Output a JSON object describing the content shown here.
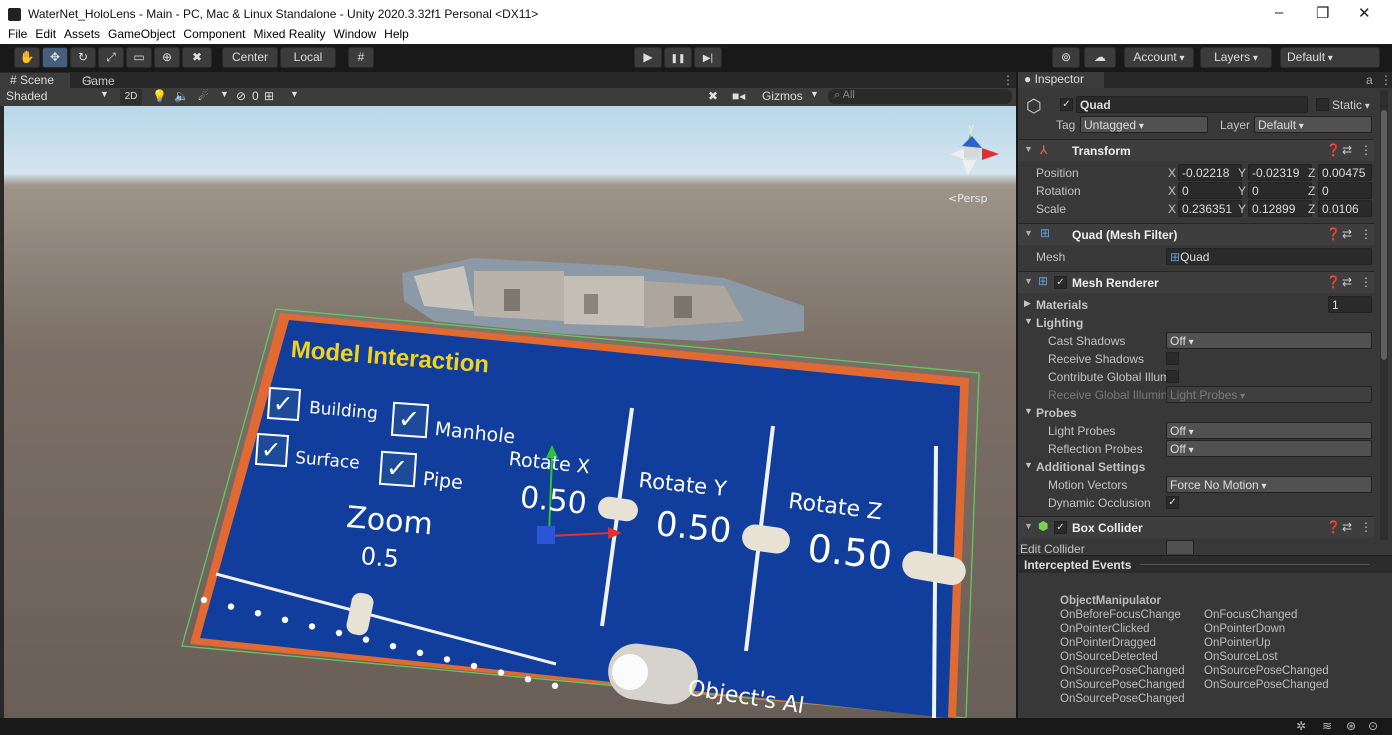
{
  "window": {
    "title": "WaterNet_HoloLens - Main - PC, Mac & Linux Standalone - Unity 2020.3.32f1 Personal <DX11>",
    "controls": [
      "–",
      "❐",
      "✕"
    ]
  },
  "menu": [
    "File",
    "Edit",
    "Assets",
    "GameObject",
    "Component",
    "Mixed Reality",
    "Window",
    "Help"
  ],
  "toolbar": {
    "tools": [
      "hand-icon",
      "move-icon",
      "rotate-icon",
      "scale-icon",
      "rect-icon",
      "transform-icon",
      "custom-tool-icon"
    ],
    "pivot": "Center",
    "space": "Local",
    "play": "▶",
    "pause": "❚❚",
    "step": "▶|",
    "account": "Account",
    "layers": "Layers",
    "layout": "Default"
  },
  "tabs": {
    "scene": "# Scene",
    "game": "Game"
  },
  "scene_toolbar": {
    "shading": "Shaded",
    "mode2d": "2D",
    "gizmos": "Gizmos",
    "search": "All",
    "hidden": "0"
  },
  "viewport": {
    "persp": "<Persp",
    "gizmo_y": "y",
    "panel": {
      "title": "Model Interaction",
      "checkboxes": [
        "Building",
        "Manhole",
        "Surface",
        "Pipe"
      ],
      "sliders": [
        {
          "label": "Zoom",
          "value": "0.5",
          "level": 0.5
        },
        {
          "label": "Rotate X",
          "value": "0.50",
          "level": 0.5
        },
        {
          "label": "Rotate Y",
          "value": "0.50",
          "level": 0.5
        },
        {
          "label": "Rotate Z",
          "value": "0.50",
          "level": 0.5
        }
      ],
      "toggle_label": "Object's Al"
    }
  },
  "inspector": {
    "tab": "Inspector",
    "object": "Quad",
    "static": "Static",
    "tag_label": "Tag",
    "tag": "Untagged",
    "layer_label": "Layer",
    "layer": "Default",
    "transform": {
      "name": "Transform",
      "position": {
        "label": "Position",
        "x": "-0.02218",
        "y": "-0.02319",
        "z": "0.00475"
      },
      "rotation": {
        "label": "Rotation",
        "x": "0",
        "y": "0",
        "z": "0"
      },
      "scale": {
        "label": "Scale",
        "x": "0.236351",
        "y": "0.12899",
        "z": "0.0106"
      }
    },
    "mesh_filter": {
      "name": "Quad (Mesh Filter)",
      "mesh_label": "Mesh",
      "mesh": "Quad"
    },
    "mesh_renderer": {
      "name": "Mesh Renderer",
      "materials": "Materials",
      "materials_count": "1",
      "lighting": "Lighting",
      "cast_shadows": "Cast Shadows",
      "cast_shadows_val": "Off",
      "receive_shadows": "Receive Shadows",
      "contribute_gi": "Contribute Global Illum",
      "receive_gi": "Receive Global Illumin",
      "receive_gi_val": "Light Probes",
      "probes": "Probes",
      "light_probes": "Light Probes",
      "light_probes_val": "Off",
      "reflection_probes": "Reflection Probes",
      "reflection_probes_val": "Off",
      "additional": "Additional Settings",
      "motion_vectors": "Motion Vectors",
      "motion_vectors_val": "Force No Motion",
      "dynamic_occlusion": "Dynamic Occlusion"
    },
    "box_collider": {
      "name": "Box Collider",
      "edit": "Edit Collider"
    }
  },
  "events": {
    "title": "Intercepted Events",
    "source": "ObjectManipulator",
    "col1": [
      "OnBeforeFocusChange",
      "OnPointerClicked",
      "OnPointerDragged",
      "OnSourceDetected",
      "OnSourcePoseChanged",
      "OnSourcePoseChanged",
      "OnSourcePoseChanged"
    ],
    "col2": [
      "OnFocusChanged",
      "OnPointerDown",
      "OnPointerUp",
      "OnSourceLost",
      "OnSourcePoseChanged",
      "OnSourcePoseChanged"
    ]
  }
}
